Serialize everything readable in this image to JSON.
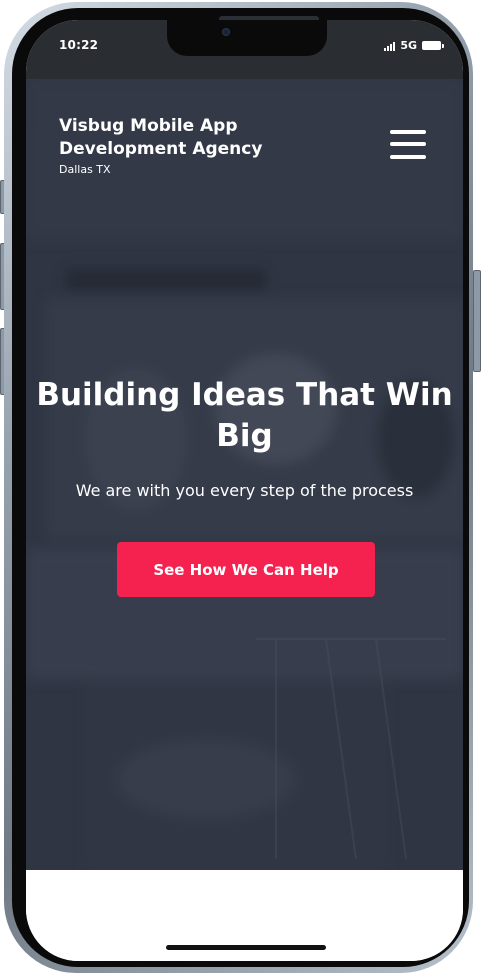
{
  "status_bar": {
    "time": "10:22",
    "network": "5G",
    "icons": [
      "signal-icon",
      "battery-icon"
    ]
  },
  "header": {
    "brand_name": "Visbug Mobile App Development Agency",
    "location": "Dallas TX",
    "menu_icon": "hamburger-menu-icon"
  },
  "hero": {
    "headline": "Building Ideas That Win Big",
    "subheadline": "We are with you every step of the process",
    "cta_label": "See How We Can Help"
  },
  "colors": {
    "accent": "#f5214f",
    "hero_overlay": "#2f3542",
    "status_bar": "#2a2e33"
  }
}
